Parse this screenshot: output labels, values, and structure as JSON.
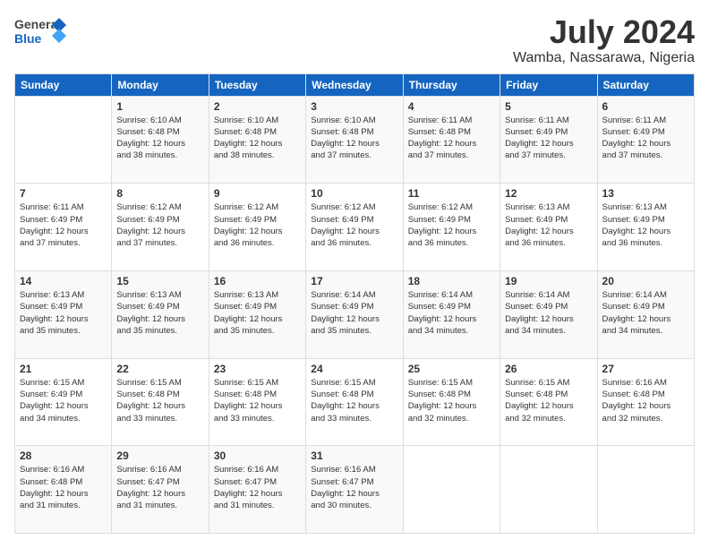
{
  "logo": {
    "line1": "General",
    "line2": "Blue"
  },
  "title": "July 2024",
  "location": "Wamba, Nassarawa, Nigeria",
  "days_of_week": [
    "Sunday",
    "Monday",
    "Tuesday",
    "Wednesday",
    "Thursday",
    "Friday",
    "Saturday"
  ],
  "weeks": [
    [
      {
        "day": "",
        "info": ""
      },
      {
        "day": "1",
        "info": "Sunrise: 6:10 AM\nSunset: 6:48 PM\nDaylight: 12 hours\nand 38 minutes."
      },
      {
        "day": "2",
        "info": "Sunrise: 6:10 AM\nSunset: 6:48 PM\nDaylight: 12 hours\nand 38 minutes."
      },
      {
        "day": "3",
        "info": "Sunrise: 6:10 AM\nSunset: 6:48 PM\nDaylight: 12 hours\nand 37 minutes."
      },
      {
        "day": "4",
        "info": "Sunrise: 6:11 AM\nSunset: 6:48 PM\nDaylight: 12 hours\nand 37 minutes."
      },
      {
        "day": "5",
        "info": "Sunrise: 6:11 AM\nSunset: 6:49 PM\nDaylight: 12 hours\nand 37 minutes."
      },
      {
        "day": "6",
        "info": "Sunrise: 6:11 AM\nSunset: 6:49 PM\nDaylight: 12 hours\nand 37 minutes."
      }
    ],
    [
      {
        "day": "7",
        "info": "Sunrise: 6:11 AM\nSunset: 6:49 PM\nDaylight: 12 hours\nand 37 minutes."
      },
      {
        "day": "8",
        "info": "Sunrise: 6:12 AM\nSunset: 6:49 PM\nDaylight: 12 hours\nand 37 minutes."
      },
      {
        "day": "9",
        "info": "Sunrise: 6:12 AM\nSunset: 6:49 PM\nDaylight: 12 hours\nand 36 minutes."
      },
      {
        "day": "10",
        "info": "Sunrise: 6:12 AM\nSunset: 6:49 PM\nDaylight: 12 hours\nand 36 minutes."
      },
      {
        "day": "11",
        "info": "Sunrise: 6:12 AM\nSunset: 6:49 PM\nDaylight: 12 hours\nand 36 minutes."
      },
      {
        "day": "12",
        "info": "Sunrise: 6:13 AM\nSunset: 6:49 PM\nDaylight: 12 hours\nand 36 minutes."
      },
      {
        "day": "13",
        "info": "Sunrise: 6:13 AM\nSunset: 6:49 PM\nDaylight: 12 hours\nand 36 minutes."
      }
    ],
    [
      {
        "day": "14",
        "info": "Sunrise: 6:13 AM\nSunset: 6:49 PM\nDaylight: 12 hours\nand 35 minutes."
      },
      {
        "day": "15",
        "info": "Sunrise: 6:13 AM\nSunset: 6:49 PM\nDaylight: 12 hours\nand 35 minutes."
      },
      {
        "day": "16",
        "info": "Sunrise: 6:13 AM\nSunset: 6:49 PM\nDaylight: 12 hours\nand 35 minutes."
      },
      {
        "day": "17",
        "info": "Sunrise: 6:14 AM\nSunset: 6:49 PM\nDaylight: 12 hours\nand 35 minutes."
      },
      {
        "day": "18",
        "info": "Sunrise: 6:14 AM\nSunset: 6:49 PM\nDaylight: 12 hours\nand 34 minutes."
      },
      {
        "day": "19",
        "info": "Sunrise: 6:14 AM\nSunset: 6:49 PM\nDaylight: 12 hours\nand 34 minutes."
      },
      {
        "day": "20",
        "info": "Sunrise: 6:14 AM\nSunset: 6:49 PM\nDaylight: 12 hours\nand 34 minutes."
      }
    ],
    [
      {
        "day": "21",
        "info": "Sunrise: 6:15 AM\nSunset: 6:49 PM\nDaylight: 12 hours\nand 34 minutes."
      },
      {
        "day": "22",
        "info": "Sunrise: 6:15 AM\nSunset: 6:48 PM\nDaylight: 12 hours\nand 33 minutes."
      },
      {
        "day": "23",
        "info": "Sunrise: 6:15 AM\nSunset: 6:48 PM\nDaylight: 12 hours\nand 33 minutes."
      },
      {
        "day": "24",
        "info": "Sunrise: 6:15 AM\nSunset: 6:48 PM\nDaylight: 12 hours\nand 33 minutes."
      },
      {
        "day": "25",
        "info": "Sunrise: 6:15 AM\nSunset: 6:48 PM\nDaylight: 12 hours\nand 32 minutes."
      },
      {
        "day": "26",
        "info": "Sunrise: 6:15 AM\nSunset: 6:48 PM\nDaylight: 12 hours\nand 32 minutes."
      },
      {
        "day": "27",
        "info": "Sunrise: 6:16 AM\nSunset: 6:48 PM\nDaylight: 12 hours\nand 32 minutes."
      }
    ],
    [
      {
        "day": "28",
        "info": "Sunrise: 6:16 AM\nSunset: 6:48 PM\nDaylight: 12 hours\nand 31 minutes."
      },
      {
        "day": "29",
        "info": "Sunrise: 6:16 AM\nSunset: 6:47 PM\nDaylight: 12 hours\nand 31 minutes."
      },
      {
        "day": "30",
        "info": "Sunrise: 6:16 AM\nSunset: 6:47 PM\nDaylight: 12 hours\nand 31 minutes."
      },
      {
        "day": "31",
        "info": "Sunrise: 6:16 AM\nSunset: 6:47 PM\nDaylight: 12 hours\nand 30 minutes."
      },
      {
        "day": "",
        "info": ""
      },
      {
        "day": "",
        "info": ""
      },
      {
        "day": "",
        "info": ""
      }
    ]
  ]
}
